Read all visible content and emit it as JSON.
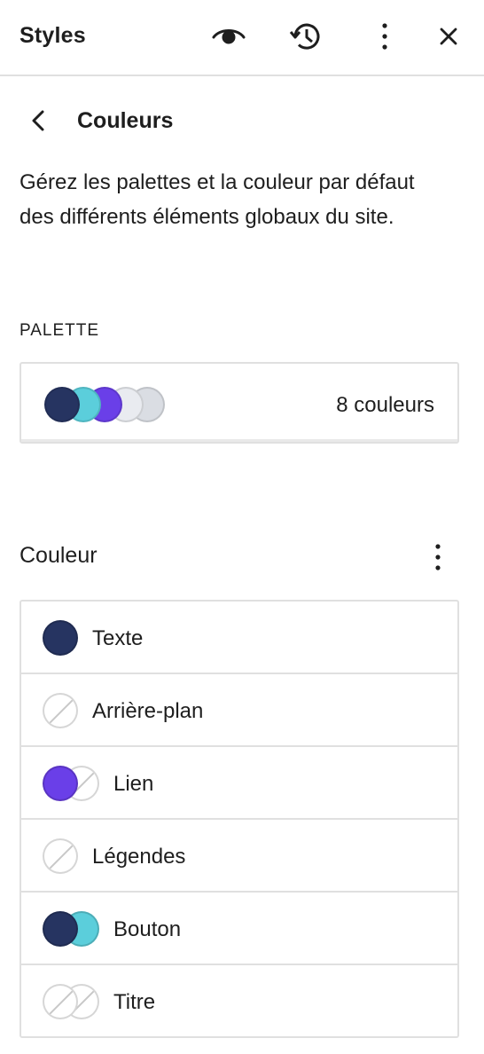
{
  "header": {
    "title": "Styles",
    "icons": [
      "eye-icon",
      "history-icon",
      "more-vertical-icon",
      "close-icon"
    ]
  },
  "nav": {
    "back_icon": "chevron-left-icon",
    "title": "Couleurs"
  },
  "description": "Gérez les palettes et la couleur par défaut des différents éléments globaux du site.",
  "palette": {
    "label": "Palette",
    "swatches": [
      "#263461",
      "#5BCEDB",
      "#6A3FE8",
      "#E9EBF0",
      "#DADDE3"
    ],
    "count_label": "8 couleurs"
  },
  "couleur": {
    "heading": "Couleur",
    "more_icon": "more-vertical-icon",
    "items": [
      {
        "label": "Texte",
        "colors": [
          "#263461"
        ]
      },
      {
        "label": "Arrière-plan",
        "colors": [
          "none"
        ]
      },
      {
        "label": "Lien",
        "colors": [
          "#6A3FE8",
          "none"
        ]
      },
      {
        "label": "Légendes",
        "colors": [
          "none"
        ]
      },
      {
        "label": "Bouton",
        "colors": [
          "#263461",
          "#5BCEDB"
        ]
      },
      {
        "label": "Titre",
        "colors": [
          "none",
          "none"
        ]
      }
    ]
  }
}
